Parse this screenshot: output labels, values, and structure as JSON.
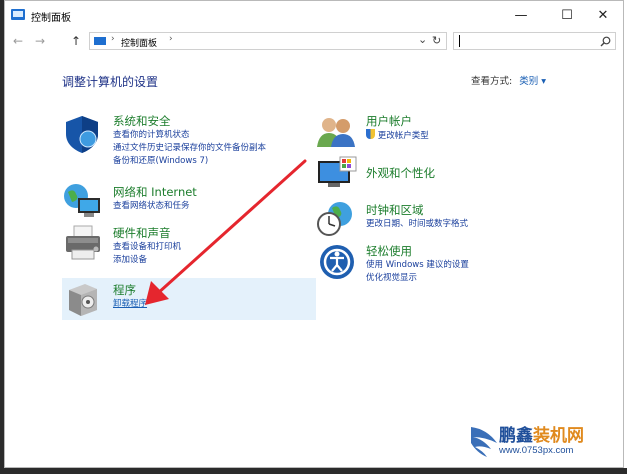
{
  "window": {
    "title": "控制面板"
  },
  "titlebar": {
    "minimize": "—",
    "maximize": "☐",
    "close": "✕"
  },
  "nav": {
    "back": "←",
    "forward": "→",
    "up": "↑",
    "breadcrumb_sep": "›",
    "breadcrumb_item": "控制面板",
    "chevron": "⌄",
    "refresh": "↻"
  },
  "search": {
    "placeholder": ""
  },
  "page": {
    "heading": "调整计算机的设置",
    "view_by_label": "查看方式:",
    "view_by_value": "类别"
  },
  "categories_left": [
    {
      "title": "系统和安全",
      "icon": "shield-icon",
      "links": [
        "查看你的计算机状态",
        "通过文件历史记录保存你的文件备份副本",
        "备份和还原(Windows 7)"
      ]
    },
    {
      "title": "网络和 Internet",
      "icon": "network-globe-icon",
      "links": [
        "查看网络状态和任务"
      ]
    },
    {
      "title": "硬件和声音",
      "icon": "printer-icon",
      "links": [
        "查看设备和打印机",
        "添加设备"
      ]
    },
    {
      "title": "程序",
      "icon": "program-box-icon",
      "links": [
        "卸载程序"
      ]
    }
  ],
  "categories_right": [
    {
      "title": "用户帐户",
      "icon": "users-icon",
      "links": [
        "更改帐户类型"
      ]
    },
    {
      "title": "外观和个性化",
      "icon": "monitor-palette-icon",
      "links": []
    },
    {
      "title": "时钟和区域",
      "icon": "clock-globe-icon",
      "links": [
        "更改日期、时间或数字格式"
      ]
    },
    {
      "title": "轻松使用",
      "icon": "ease-of-access-icon",
      "links": [
        "使用 Windows 建议的设置",
        "优化视觉显示"
      ]
    }
  ],
  "watermark": {
    "brand_line1a": "鹏鑫",
    "brand_line1b": "装机网",
    "brand_line2": "www.0753px.com"
  },
  "colors": {
    "category_title": "#1c7d2c",
    "link": "#1a3f9c",
    "accent": "#1a5fb4",
    "arrow": "#e5262e"
  }
}
